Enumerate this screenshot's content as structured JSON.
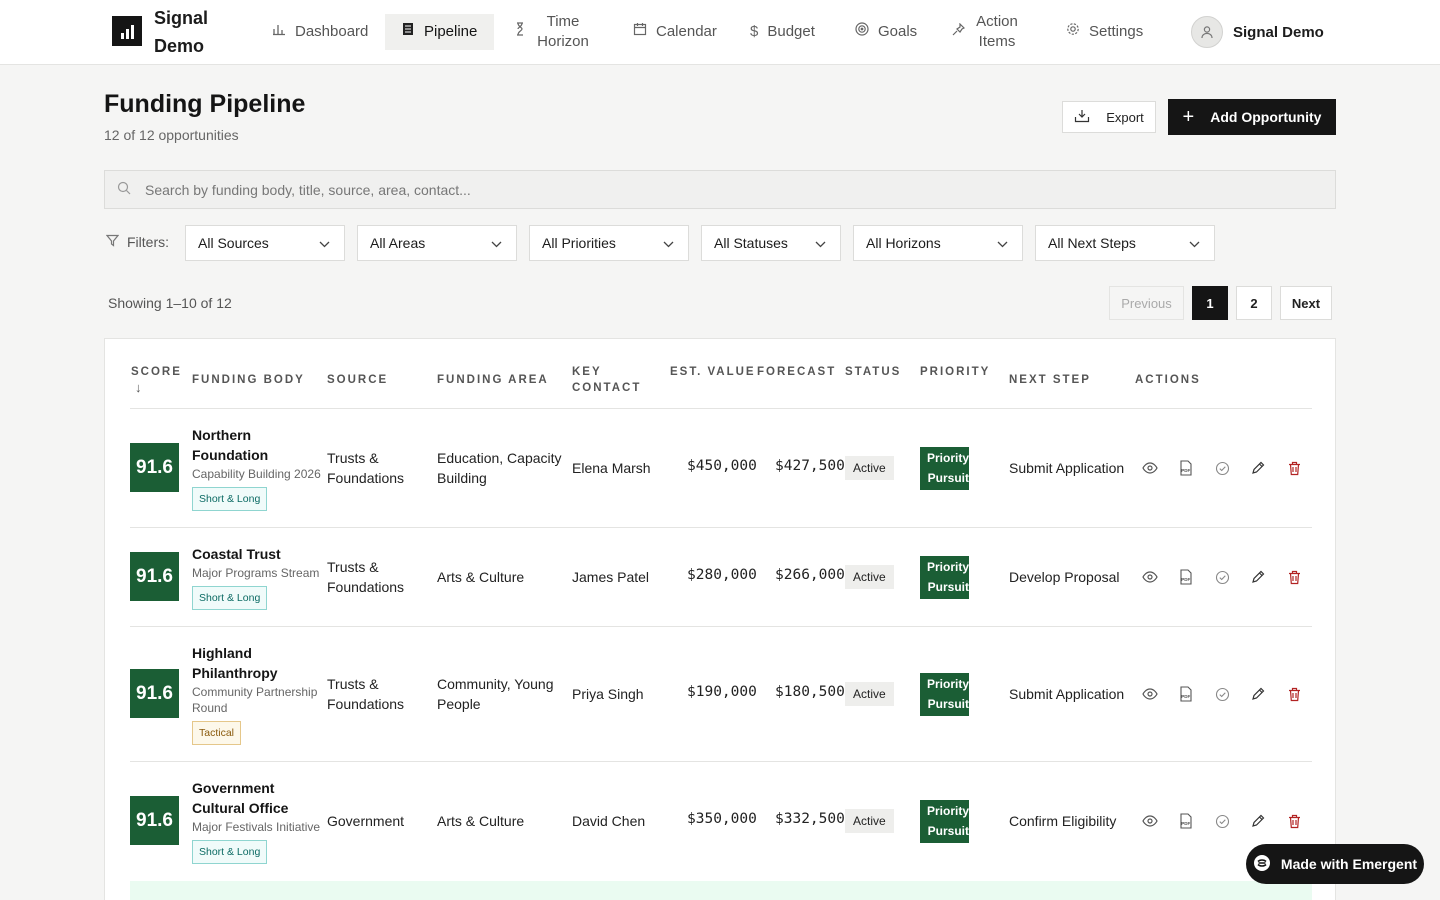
{
  "app": {
    "brand": "Signal Demo",
    "user_name": "Signal Demo"
  },
  "nav": [
    {
      "label": "Dashboard",
      "icon": "bar-chart-icon"
    },
    {
      "label": "Pipeline",
      "icon": "document-icon",
      "active": true
    },
    {
      "label": "Time Horizon",
      "icon": "hourglass-icon"
    },
    {
      "label": "Calendar",
      "icon": "calendar-icon"
    },
    {
      "label": "Budget",
      "icon": "dollar-icon"
    },
    {
      "label": "Goals",
      "icon": "target-icon"
    },
    {
      "label": "Action Items",
      "icon": "pin-icon"
    },
    {
      "label": "Settings",
      "icon": "gear-icon"
    }
  ],
  "page": {
    "title": "Funding Pipeline",
    "subtitle": "12 of 12 opportunities",
    "export_label": "Export",
    "add_label": "Add Opportunity"
  },
  "search": {
    "placeholder": "Search by funding body, title, source, area, contact..."
  },
  "filters": {
    "label": "Filters:",
    "sources": "All Sources",
    "areas": "All Areas",
    "priorities": "All Priorities",
    "statuses": "All Statuses",
    "horizons": "All Horizons",
    "next_steps": "All Next Steps"
  },
  "pagination": {
    "showing": "Showing 1–10 of 12",
    "previous": "Previous",
    "pages": [
      "1",
      "2"
    ],
    "current": "1",
    "next": "Next"
  },
  "table": {
    "headers": {
      "score": "SCORE",
      "score_sort": "↓",
      "funding_body": "FUNDING BODY",
      "source": "SOURCE",
      "funding_area": "FUNDING AREA",
      "key_contact_1": "KEY",
      "key_contact_2": "CONTACT",
      "est_value": "EST. VALUE",
      "forecast": "FORECAST",
      "status": "STATUS",
      "priority": "PRIORITY",
      "next_step": "NEXT STEP",
      "actions": "ACTIONS"
    },
    "rows": [
      {
        "score": "91.6",
        "name_1": "Northern",
        "name_2": "Foundation",
        "title": "Capability Building 2026",
        "title_2": "",
        "tag": "Short & Long",
        "source_1": "Trusts &",
        "source_2": "Foundations",
        "area_1": "Education, Capacity",
        "area_2": "Building",
        "contact": "Elena Marsh",
        "est_value": "$450,000",
        "forecast": "$427,500",
        "status": "Active",
        "priority_1": "Priority",
        "priority_2": "Pursuit",
        "next_step": "Submit Application"
      },
      {
        "score": "91.6",
        "name_1": "Coastal Trust",
        "name_2": "",
        "title": "Major Programs Stream",
        "title_2": "",
        "tag": "Short & Long",
        "source_1": "Trusts &",
        "source_2": "Foundations",
        "area_1": "Arts & Culture",
        "area_2": "",
        "contact": "James Patel",
        "est_value": "$280,000",
        "forecast": "$266,000",
        "status": "Active",
        "priority_1": "Priority",
        "priority_2": "Pursuit",
        "next_step": "Develop Proposal"
      },
      {
        "score": "91.6",
        "name_1": "Highland",
        "name_2": "Philanthropy",
        "title": "Community Partnership",
        "title_2": "Round",
        "tag": "Tactical",
        "source_1": "Trusts &",
        "source_2": "Foundations",
        "area_1": "Community, Young",
        "area_2": "People",
        "contact": "Priya Singh",
        "est_value": "$190,000",
        "forecast": "$180,500",
        "status": "Active",
        "priority_1": "Priority",
        "priority_2": "Pursuit",
        "next_step": "Submit Application"
      },
      {
        "score": "91.6",
        "name_1": "Government",
        "name_2": "Cultural Office",
        "title": "Major Festivals Initiative",
        "title_2": "",
        "tag": "Short & Long",
        "source_1": "Government",
        "source_2": "",
        "area_1": "Arts & Culture",
        "area_2": "",
        "contact": "David Chen",
        "est_value": "$350,000",
        "forecast": "$332,500",
        "status": "Active",
        "priority_1": "Priority",
        "priority_2": "Pursuit",
        "next_step": "Confirm Eligibility"
      }
    ]
  },
  "badge": {
    "label": "Made with Emergent"
  },
  "colors": {
    "score_bg": "#1b5e35",
    "accent": "#151515",
    "tag_teal": "#0c6b64",
    "tag_amber": "#8a5a0c"
  }
}
